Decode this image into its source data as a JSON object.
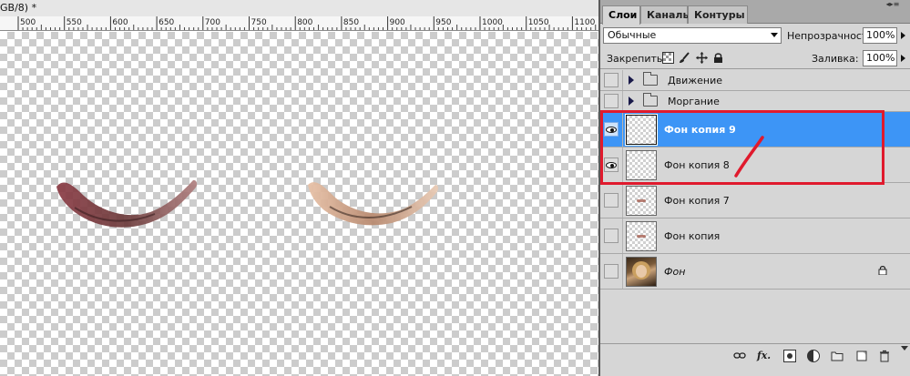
{
  "document": {
    "title": "GB/8) *",
    "ruler": {
      "ticks": [
        "500",
        "550",
        "600",
        "650",
        "700",
        "750",
        "800",
        "850",
        "900",
        "950",
        "1000",
        "1050",
        "1100"
      ]
    }
  },
  "layers_panel": {
    "tabs": [
      {
        "label": "Слои",
        "active": true
      },
      {
        "label": "Каналы",
        "active": false
      },
      {
        "label": "Контуры",
        "active": false
      }
    ],
    "blend_mode": "Обычные",
    "opacity_label": "Непрозрачность:",
    "opacity_value": "100%",
    "lock_label": "Закрепить:",
    "fill_label": "Заливка:",
    "fill_value": "100%",
    "groups": [
      {
        "label": "Движение",
        "visible": false
      },
      {
        "label": "Моргание",
        "visible": false
      }
    ],
    "layers": [
      {
        "label": "Фон копия 9",
        "visible": true,
        "selected": true
      },
      {
        "label": "Фон копия 8",
        "visible": true,
        "selected": false
      },
      {
        "label": "Фон копия 7",
        "visible": false,
        "selected": false
      },
      {
        "label": "Фон копия",
        "visible": false,
        "selected": false
      },
      {
        "label": "Фон",
        "visible": false,
        "selected": false,
        "locked": true
      }
    ],
    "bottom_icons": [
      "link-icon",
      "fx-icon",
      "layer-mask-icon",
      "adjustment-layer-icon",
      "new-group-icon",
      "new-layer-icon",
      "trash-icon"
    ]
  },
  "colors": {
    "selection": "#3d95f6",
    "annotation_red": "#e01a2d"
  }
}
